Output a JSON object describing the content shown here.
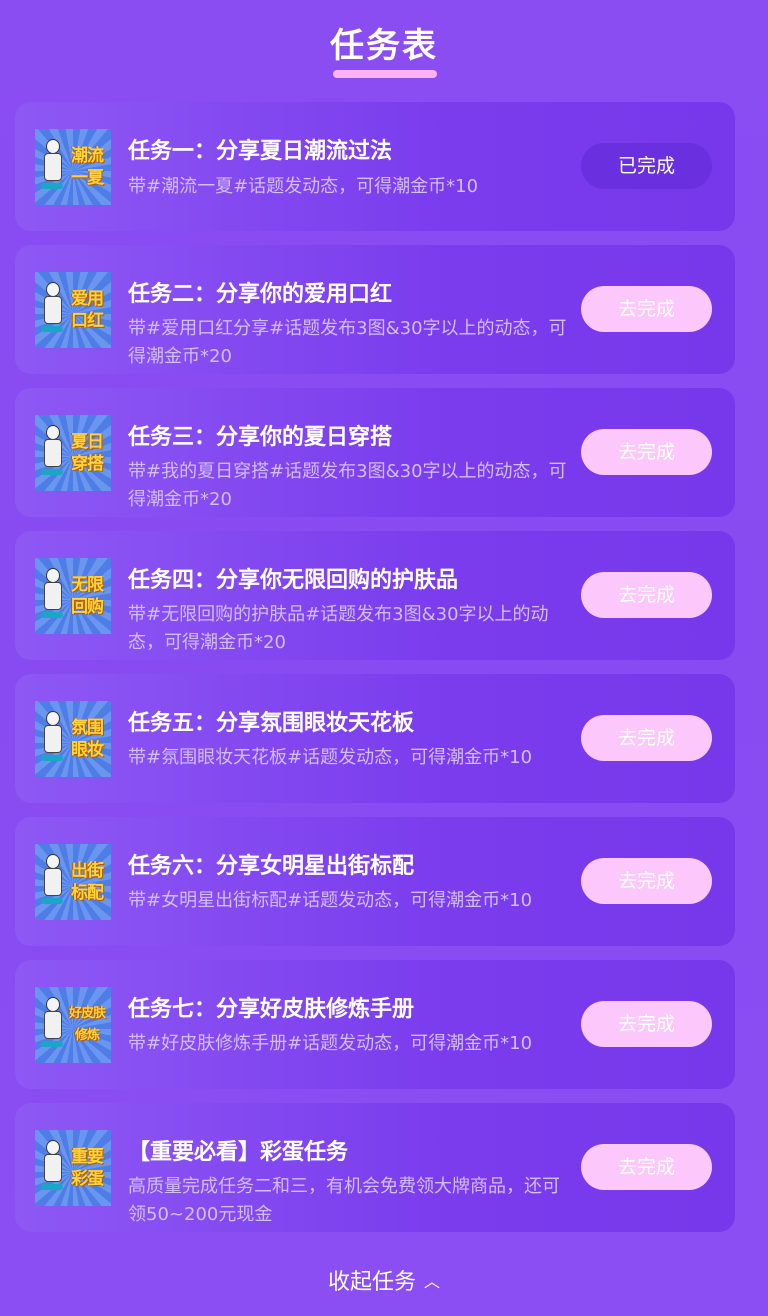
{
  "header": {
    "title": "任务表"
  },
  "tasks": [
    {
      "thumb_text": "潮流一夏",
      "title": "任务一：分享夏日潮流过法",
      "desc": "带#潮流一夏#话题发动态，可得潮金币*10",
      "button": "已完成",
      "status": "done"
    },
    {
      "thumb_text": "爱用口红",
      "title": "任务二：分享你的爱用口红",
      "desc": "带#爱用口红分享#话题发布3图&30字以上的动态，可得潮金币*20",
      "button": "去完成",
      "status": "todo"
    },
    {
      "thumb_text": "夏日穿搭",
      "title": "任务三：分享你的夏日穿搭",
      "desc": "带#我的夏日穿搭#话题发布3图&30字以上的动态，可得潮金币*20",
      "button": "去完成",
      "status": "todo"
    },
    {
      "thumb_text": "无限回购",
      "title": "任务四：分享你无限回购的护肤品",
      "desc": "带#无限回购的护肤品#话题发布3图&30字以上的动态，可得潮金币*20",
      "button": "去完成",
      "status": "todo"
    },
    {
      "thumb_text": "氛围眼妆",
      "title": "任务五：分享氛围眼妆天花板",
      "desc": "带#氛围眼妆天花板#话题发动态，可得潮金币*10",
      "button": "去完成",
      "status": "todo"
    },
    {
      "thumb_text": "出街标配",
      "title": "任务六：分享女明星出街标配",
      "desc": "带#女明星出街标配#话题发动态，可得潮金币*10",
      "button": "去完成",
      "status": "todo"
    },
    {
      "thumb_text": "好皮肤修炼",
      "title": "任务七：分享好皮肤修炼手册",
      "desc": "带#好皮肤修炼手册#话题发动态，可得潮金币*10",
      "button": "去完成",
      "status": "todo"
    },
    {
      "thumb_text": "重要彩蛋",
      "title": "【重要必看】彩蛋任务",
      "desc": "高质量完成任务二和三，有机会免费领大牌商品，还可领50~200元现金",
      "button": "去完成",
      "status": "todo"
    }
  ],
  "footer": {
    "collapse_label": "收起任务",
    "collapse_icon": "chevron-up-icon"
  },
  "colors": {
    "background": "#8a4df2",
    "card": "#7a3ced",
    "button_todo": "#fcc8fb",
    "button_done": "#6a30df",
    "thumb_text": "#ffd33a"
  }
}
